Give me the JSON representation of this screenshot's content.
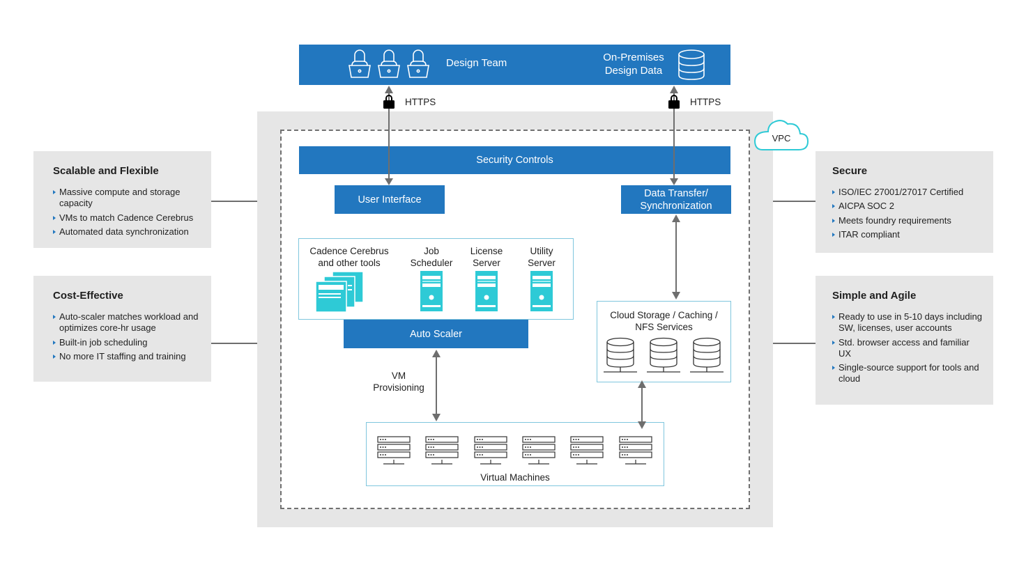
{
  "top_bar": {
    "design_team_label": "Design Team",
    "on_prem_line1": "On-Premises",
    "on_prem_line2": "Design Data",
    "icons": [
      "user-laptop-icon",
      "user-laptop-icon",
      "user-laptop-icon",
      "database-icon"
    ]
  },
  "connections": {
    "left_protocol": "HTTPS",
    "right_protocol": "HTTPS",
    "vm_provisioning_line1": "VM",
    "vm_provisioning_line2": "Provisioning"
  },
  "vpc": {
    "cloud_label": "VPC",
    "security_controls": "Security Controls",
    "user_interface": "User Interface",
    "data_transfer_line1": "Data Transfer/",
    "data_transfer_line2": "Synchronization",
    "tools_box": {
      "items": [
        {
          "line1": "Cadence Cerebrus",
          "line2": "and other tools",
          "icon": "app-windows-icon"
        },
        {
          "line1": "Job",
          "line2": "Scheduler",
          "icon": "server-tower-icon"
        },
        {
          "line1": "License",
          "line2": "Server",
          "icon": "server-tower-icon"
        },
        {
          "line1": "Utility",
          "line2": "Server",
          "icon": "server-tower-icon"
        }
      ]
    },
    "auto_scaler": "Auto Scaler",
    "storage": {
      "line1": "Cloud Storage / Caching /",
      "line2": "NFS Services",
      "icon_count": 3
    },
    "virtual_machines": {
      "label": "Virtual Machines",
      "icon_count": 6
    }
  },
  "left_panels": [
    {
      "title": "Scalable and Flexible",
      "bullets": [
        "Massive compute and storage capacity",
        "VMs to match Cadence Cerebrus",
        "Automated data synchronization"
      ]
    },
    {
      "title": "Cost-Effective",
      "bullets": [
        "Auto-scaler matches workload and optimizes core-hr usage",
        "Built-in job scheduling",
        "No more IT staffing and training"
      ]
    }
  ],
  "right_panels": [
    {
      "title": "Secure",
      "bullets": [
        "ISO/IEC 27001/27017 Certified",
        "AICPA SOC 2",
        "Meets foundry requirements",
        "ITAR compliant"
      ]
    },
    {
      "title": "Simple and Agile",
      "bullets": [
        "Ready to use in 5-10 days including SW, licenses, user accounts",
        "Std. browser access and familiar UX",
        "Single-source support for tools and cloud"
      ]
    }
  ],
  "colors": {
    "primary_blue": "#2277bf",
    "teal_icon": "#2ecad6",
    "panel_gray": "#e6e6e6",
    "arrow_gray": "#6e6e6e"
  }
}
